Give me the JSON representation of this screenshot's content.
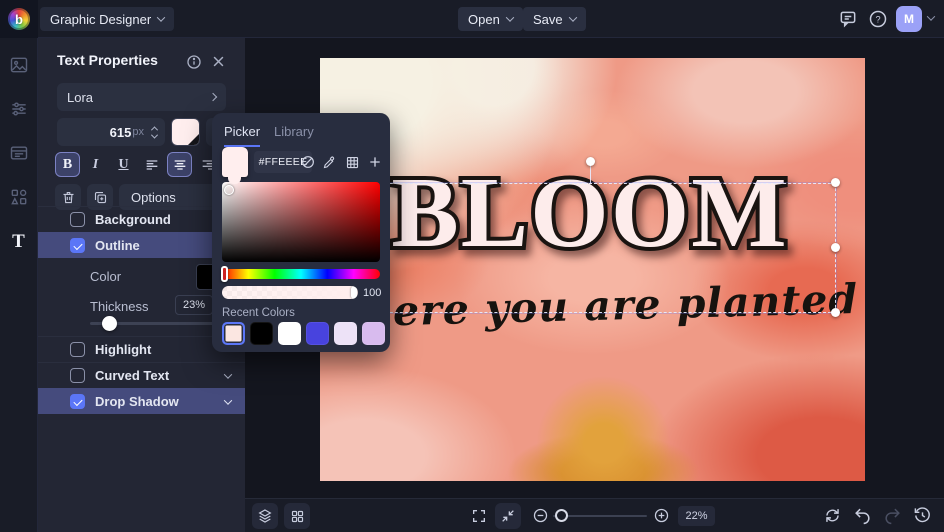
{
  "topbar": {
    "logo_letter": "b",
    "mode_label": "Graphic Designer",
    "open_label": "Open",
    "save_label": "Save",
    "help_glyph": "?",
    "avatar_initial": "M"
  },
  "left_toolbar": {
    "text_tool_glyph": "T"
  },
  "panel": {
    "title": "Text Properties",
    "font_family": "Lora",
    "font_size": "615",
    "font_size_unit": "px",
    "style_buttons": {
      "bold": "B",
      "italic": "I",
      "underline": "U"
    },
    "options_label": "Options",
    "rows": {
      "background": {
        "label": "Background",
        "checked": false
      },
      "outline": {
        "label": "Outline",
        "checked": true
      },
      "highlight": {
        "label": "Highlight",
        "checked": false
      },
      "curved_text": {
        "label": "Curved Text",
        "checked": false
      },
      "drop_shadow": {
        "label": "Drop Shadow",
        "checked": true
      }
    },
    "outline_controls": {
      "color_label": "Color",
      "color_value": "#000000",
      "thickness_label": "Thickness",
      "thickness_value": "23%"
    }
  },
  "color_picker": {
    "tabs": [
      {
        "label": "Picker",
        "active": true
      },
      {
        "label": "Library",
        "active": false
      }
    ],
    "hex_value": "#FFEEEE",
    "current_color": "#FFEEEE",
    "opacity_value": "100",
    "recent_colors_label": "Recent Colors",
    "recent_colors": [
      "#FBE6E1",
      "#000000",
      "#FFFFFF",
      "#4843DE",
      "#EDE2F7",
      "#D8BBEE"
    ]
  },
  "canvas": {
    "title_text": "BLOOM",
    "subtitle_text": "where you are planted",
    "title_color": "#FFEEEE"
  },
  "bottom_toolbar": {
    "zoom_value": "22%"
  }
}
